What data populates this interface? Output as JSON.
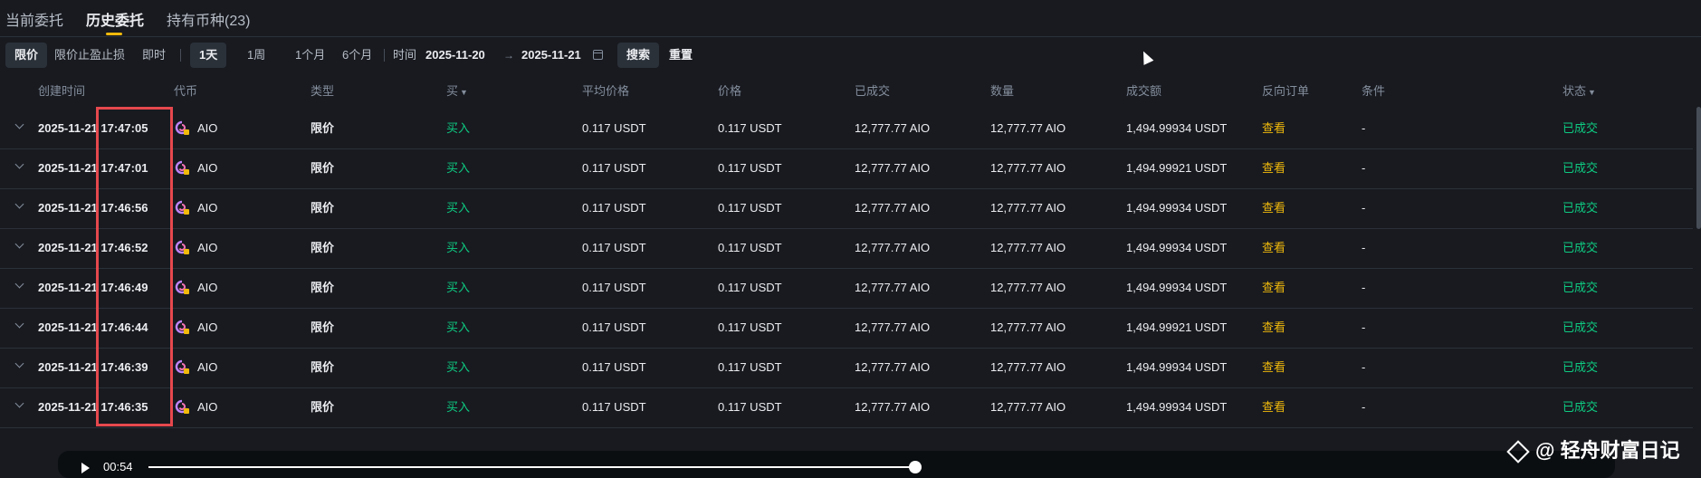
{
  "tabs": [
    {
      "label": "当前委托",
      "active": false
    },
    {
      "label": "历史委托",
      "active": true
    },
    {
      "label": "持有币种(23)",
      "active": false
    }
  ],
  "filters": {
    "order_types": [
      "限价",
      "限价止盈止损",
      "即时"
    ],
    "periods": [
      "1天",
      "1周",
      "1个月",
      "6个月"
    ],
    "time_label": "时间",
    "start_date": "2025-11-20",
    "end_date": "2025-11-21",
    "search_label": "搜索",
    "reset_label": "重置"
  },
  "table": {
    "headers": {
      "create_time": "创建时间",
      "coin": "代币",
      "type": "类型",
      "side": "买",
      "avg_price": "平均价格",
      "price": "价格",
      "filled": "已成交",
      "amount": "数量",
      "turnover": "成交额",
      "reverse_order": "反向订单",
      "condition": "条件",
      "status": "状态"
    },
    "rows": [
      {
        "time": "2025-11-21 17:47:05",
        "coin": "AIO",
        "type": "限价",
        "side": "买入",
        "avg_price": "0.117 USDT",
        "price": "0.117 USDT",
        "filled": "12,777.77 AIO",
        "amount": "12,777.77 AIO",
        "turnover": "1,494.99934 USDT",
        "reverse": "查看",
        "condition": "-",
        "status": "已成交"
      },
      {
        "time": "2025-11-21 17:47:01",
        "coin": "AIO",
        "type": "限价",
        "side": "买入",
        "avg_price": "0.117 USDT",
        "price": "0.117 USDT",
        "filled": "12,777.77 AIO",
        "amount": "12,777.77 AIO",
        "turnover": "1,494.99921 USDT",
        "reverse": "查看",
        "condition": "-",
        "status": "已成交"
      },
      {
        "time": "2025-11-21 17:46:56",
        "coin": "AIO",
        "type": "限价",
        "side": "买入",
        "avg_price": "0.117 USDT",
        "price": "0.117 USDT",
        "filled": "12,777.77 AIO",
        "amount": "12,777.77 AIO",
        "turnover": "1,494.99934 USDT",
        "reverse": "查看",
        "condition": "-",
        "status": "已成交"
      },
      {
        "time": "2025-11-21 17:46:52",
        "coin": "AIO",
        "type": "限价",
        "side": "买入",
        "avg_price": "0.117 USDT",
        "price": "0.117 USDT",
        "filled": "12,777.77 AIO",
        "amount": "12,777.77 AIO",
        "turnover": "1,494.99934 USDT",
        "reverse": "查看",
        "condition": "-",
        "status": "已成交"
      },
      {
        "time": "2025-11-21 17:46:49",
        "coin": "AIO",
        "type": "限价",
        "side": "买入",
        "avg_price": "0.117 USDT",
        "price": "0.117 USDT",
        "filled": "12,777.77 AIO",
        "amount": "12,777.77 AIO",
        "turnover": "1,494.99934 USDT",
        "reverse": "查看",
        "condition": "-",
        "status": "已成交"
      },
      {
        "time": "2025-11-21 17:46:44",
        "coin": "AIO",
        "type": "限价",
        "side": "买入",
        "avg_price": "0.117 USDT",
        "price": "0.117 USDT",
        "filled": "12,777.77 AIO",
        "amount": "12,777.77 AIO",
        "turnover": "1,494.99921 USDT",
        "reverse": "查看",
        "condition": "-",
        "status": "已成交"
      },
      {
        "time": "2025-11-21 17:46:39",
        "coin": "AIO",
        "type": "限价",
        "side": "买入",
        "avg_price": "0.117 USDT",
        "price": "0.117 USDT",
        "filled": "12,777.77 AIO",
        "amount": "12,777.77 AIO",
        "turnover": "1,494.99934 USDT",
        "reverse": "查看",
        "condition": "-",
        "status": "已成交"
      },
      {
        "time": "2025-11-21 17:46:35",
        "coin": "AIO",
        "type": "限价",
        "side": "买入",
        "avg_price": "0.117 USDT",
        "price": "0.117 USDT",
        "filled": "12,777.77 AIO",
        "amount": "12,777.77 AIO",
        "turnover": "1,494.99934 USDT",
        "reverse": "查看",
        "condition": "-",
        "status": "已成交"
      }
    ]
  },
  "player": {
    "time": "00:54",
    "progress": 0.55
  },
  "watermark": "@ 轻舟财富日记",
  "colors": {
    "accent": "#f0b90b",
    "buy": "#0ecb81",
    "highlight": "#e5484d",
    "background": "#181a20"
  }
}
